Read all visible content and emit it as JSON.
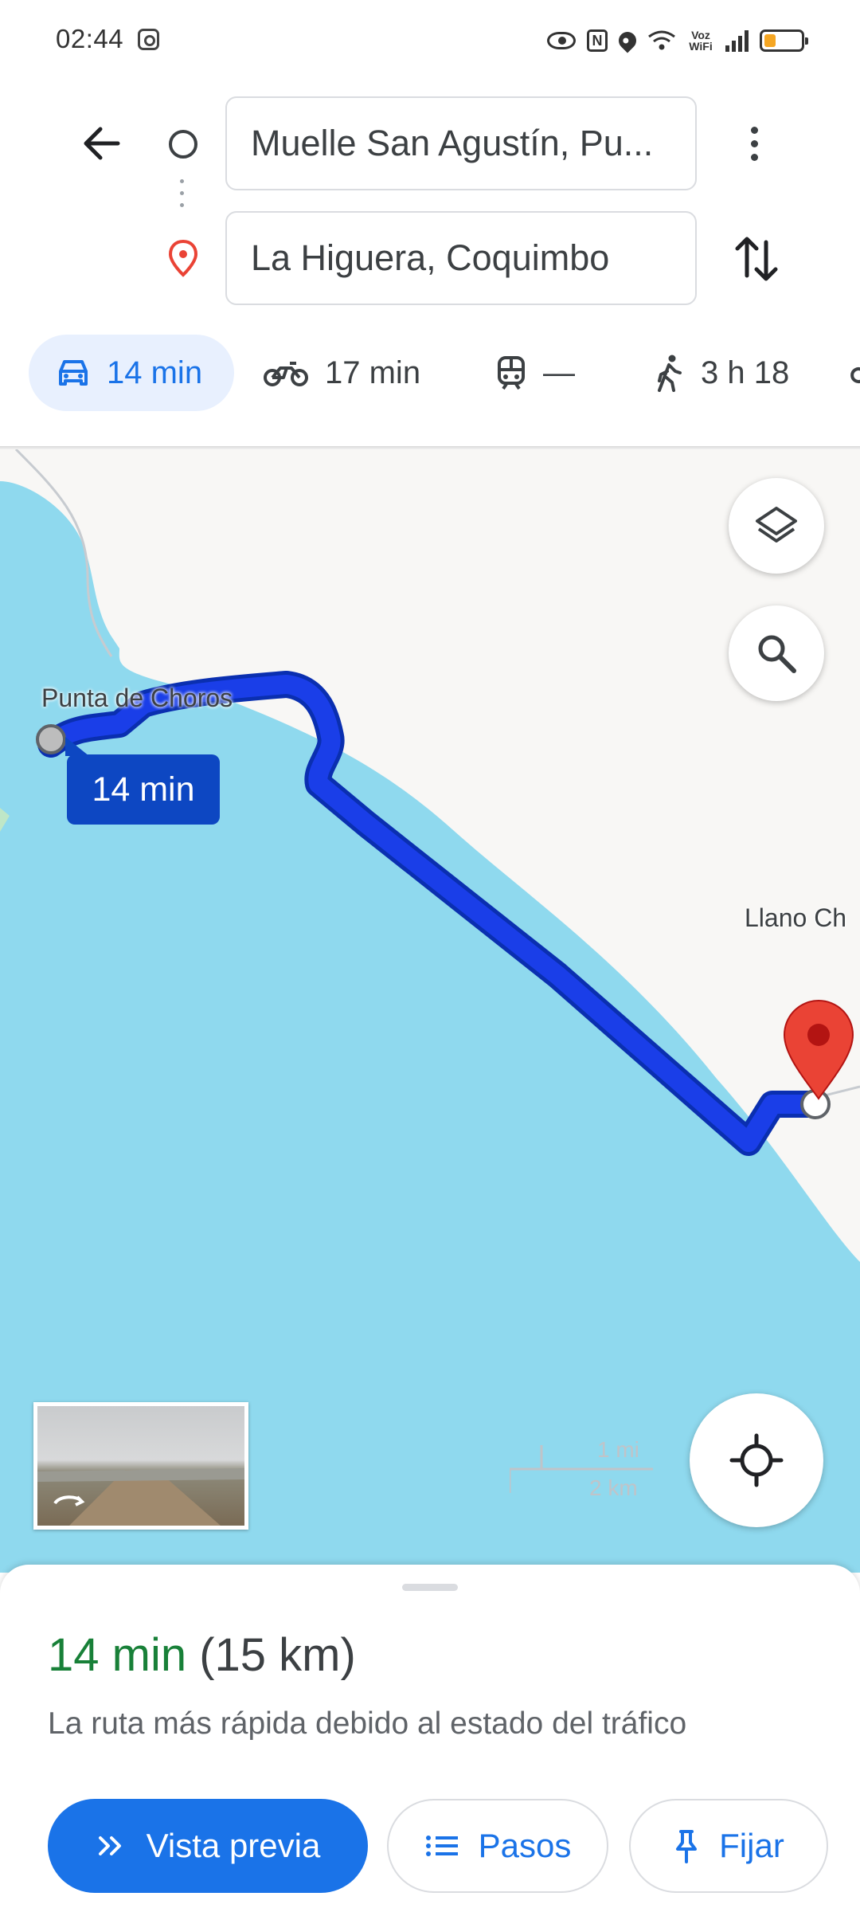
{
  "status_bar": {
    "time": "02:44",
    "voz_wifi_label": "Voz WiFi",
    "nfc_label": "N",
    "icons": [
      "instagram-icon",
      "eye-icon",
      "nfc-icon",
      "location-icon",
      "wifi-icon",
      "signal-icon",
      "battery-icon"
    ],
    "battery_level": 0.2
  },
  "directions": {
    "origin": "Muelle San Agustín, Pu...",
    "destination": "La Higuera, Coquimbo"
  },
  "modes": [
    {
      "name": "car",
      "label": "14 min",
      "selected": true
    },
    {
      "name": "motorcycle",
      "label": "17 min"
    },
    {
      "name": "transit",
      "label": "—"
    },
    {
      "name": "walk",
      "label": "3 h 18"
    }
  ],
  "map": {
    "place_labels": [
      "Punta de Choros",
      "Llano Ch"
    ],
    "route_eta": "14 min",
    "scale": {
      "imperial": "1 mi",
      "metric": "2 km"
    },
    "colors": {
      "water": "#8fd9ee",
      "land": "#f8f7f5",
      "route": "#1a3ee8",
      "pin": "#ea4335"
    }
  },
  "summary": {
    "duration": "14 min",
    "distance": "(15 km)",
    "reason": "La ruta más rápida debido al estado del tráfico"
  },
  "buttons": {
    "preview": "Vista previa",
    "steps": "Pasos",
    "pin": "Fijar"
  },
  "colors": {
    "accent": "#1a73e8",
    "duration_green": "#188038"
  }
}
